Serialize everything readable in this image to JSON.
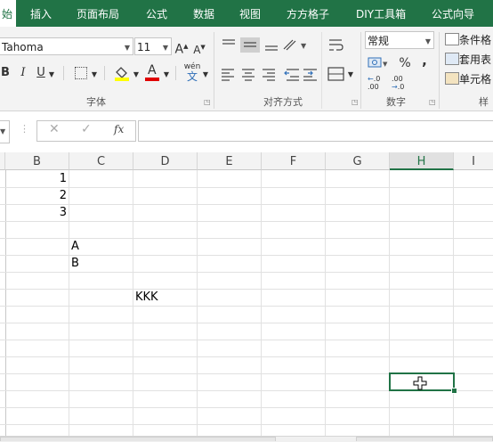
{
  "tabs": [
    {
      "label": "始",
      "active": true
    },
    {
      "label": "插入"
    },
    {
      "label": "页面布局"
    },
    {
      "label": "公式"
    },
    {
      "label": "数据"
    },
    {
      "label": "视图"
    },
    {
      "label": "方方格子"
    },
    {
      "label": "DIY工具箱"
    },
    {
      "label": "公式向导"
    }
  ],
  "font_group": {
    "font_name": "Tahoma",
    "font_size": "11",
    "grow_font": "A",
    "shrink_font": "A",
    "bold": "B",
    "italic": "I",
    "underline": "U",
    "font_color": "A",
    "phonetic": "wén",
    "label": "字体"
  },
  "alignment_group": {
    "label": "对齐方式"
  },
  "number_group": {
    "format": "常规",
    "percent": "%",
    "comma": ",",
    "inc_decimal": "←.0\n.00",
    "dec_decimal": ".00\n→.0",
    "label": "数字"
  },
  "styles_group": {
    "conditional": "条件格",
    "table_format": "套用表",
    "cell_styles": "单元格",
    "label": "样"
  },
  "formula_bar": {
    "fx": "fx",
    "cancel": "✕",
    "enter": "✓",
    "value": ""
  },
  "columns": [
    "B",
    "C",
    "D",
    "E",
    "F",
    "G",
    "H",
    "I"
  ],
  "cells": {
    "b1": "1",
    "b2": "2",
    "b3": "3",
    "c5": "A",
    "c6": "B",
    "d8": "KKK"
  },
  "colors": {
    "accent": "#217346"
  }
}
